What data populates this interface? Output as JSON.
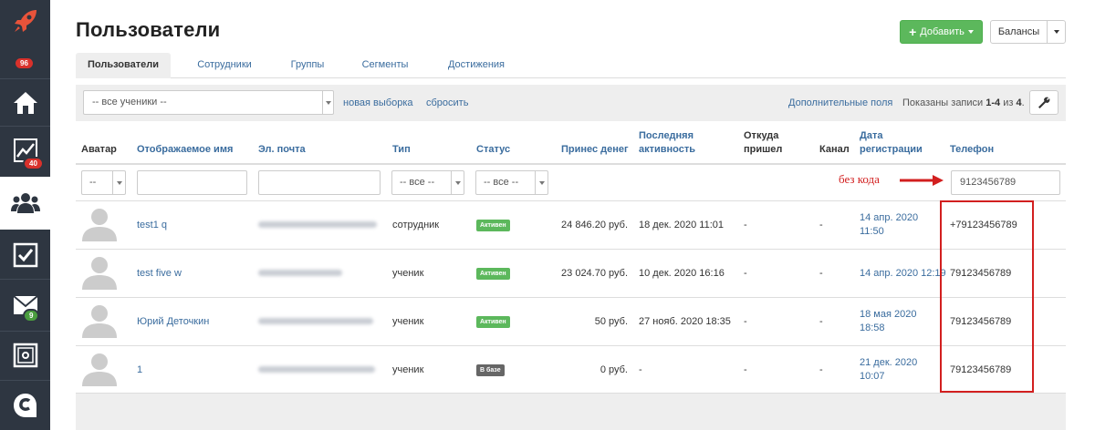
{
  "sidebar": {
    "badges": {
      "notifications": "96",
      "stats": "40",
      "messages": "9"
    }
  },
  "header": {
    "title": "Пользователи",
    "add_label": "Добавить",
    "balances_label": "Балансы"
  },
  "tabs": [
    {
      "label": "Пользователи",
      "active": true
    },
    {
      "label": "Сотрудники",
      "active": false
    },
    {
      "label": "Группы",
      "active": false
    },
    {
      "label": "Сегменты",
      "active": false
    },
    {
      "label": "Достижения",
      "active": false
    }
  ],
  "filterbar": {
    "selection_value": "-- все ученики --",
    "new_selection_link": "новая выборка",
    "reset_link": "сбросить",
    "extra_fields_link": "Дополнительные поля",
    "records_prefix": "Показаны записи ",
    "records_range": "1-4",
    "records_of": " из ",
    "records_total": "4",
    "records_suffix": "."
  },
  "table": {
    "headers": {
      "avatar": "Аватар",
      "name": "Отображаемое имя",
      "email": "Эл. почта",
      "type": "Тип",
      "status": "Статус",
      "revenue": "Принес денег",
      "last_activity_1": "Последняя",
      "last_activity_2": "активность",
      "source_1": "Откуда",
      "source_2": "пришел",
      "channel": "Канал",
      "reg_date_1": "Дата",
      "reg_date_2": "регистрации",
      "phone": "Телефон"
    },
    "filters": {
      "avatar": "--",
      "type": "-- все --",
      "status": "-- все --",
      "name": "",
      "email": "",
      "phone": "9123456789"
    },
    "rows": [
      {
        "name": "test1 q",
        "type": "сотрудник",
        "status": "Активен",
        "revenue": "24 846.20 руб.",
        "last_activity": "18 дек. 2020 11:01",
        "source": "-",
        "channel": "-",
        "reg_date_1": "14 апр. 2020",
        "reg_date_2": "11:50",
        "phone": "+79123456789"
      },
      {
        "name": "test five w",
        "type": "ученик",
        "status": "Активен",
        "revenue": "23 024.70 руб.",
        "last_activity": "10 дек. 2020 16:16",
        "source": "-",
        "channel": "-",
        "reg_date_1": "14 апр. 2020 12:19",
        "reg_date_2": "",
        "phone": "79123456789"
      },
      {
        "name": "Юрий Деточкин",
        "type": "ученик",
        "status": "Активен",
        "revenue": "50 руб.",
        "last_activity": "27 нояб. 2020 18:35",
        "source": "-",
        "channel": "-",
        "reg_date_1": "18 мая 2020",
        "reg_date_2": "18:58",
        "phone": "79123456789"
      },
      {
        "name": "1",
        "type": "ученик",
        "status": "В базе",
        "revenue": "0 руб.",
        "last_activity": "-",
        "source": "-",
        "channel": "-",
        "reg_date_1": "21 дек. 2020",
        "reg_date_2": "10:07",
        "phone": "79123456789"
      }
    ]
  },
  "annotation": {
    "text": "без кода",
    "color": "#d21f1f"
  },
  "colors": {
    "sidebar": "#2e3641",
    "link": "#3a6c9e",
    "add_button": "#5cb85c",
    "status_active": "#5cb85c",
    "status_in_base": "#666666",
    "logo": "#e8533a"
  }
}
